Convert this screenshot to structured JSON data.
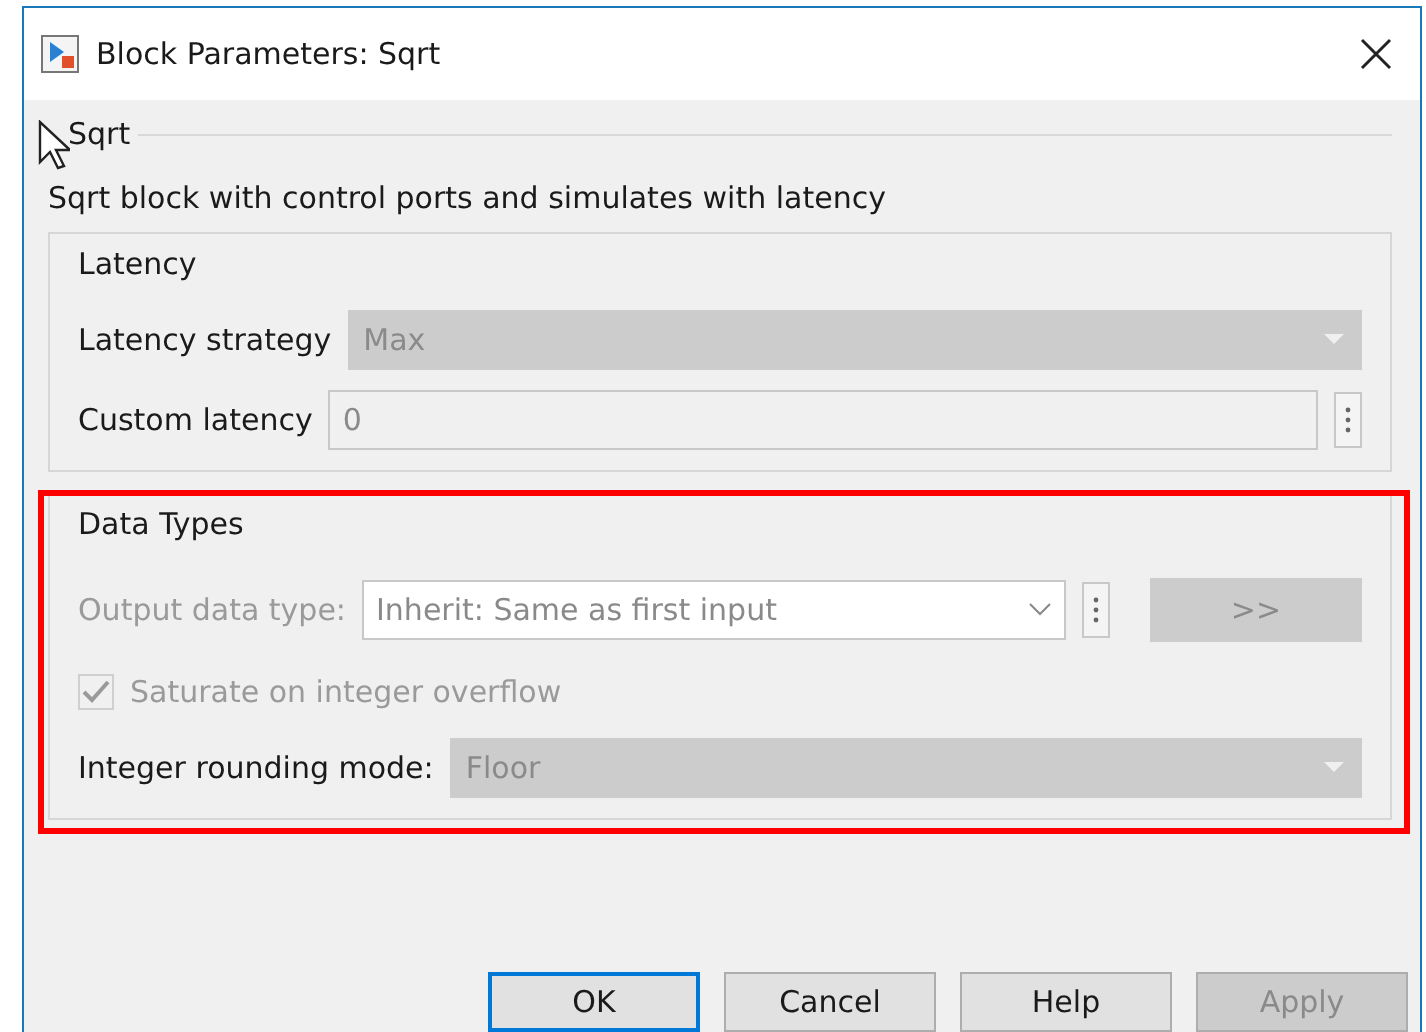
{
  "window": {
    "title": "Block Parameters: Sqrt"
  },
  "block": {
    "name": "Sqrt",
    "description": "Sqrt block with control ports and simulates with latency"
  },
  "latency": {
    "title": "Latency",
    "strategy": {
      "label": "Latency strategy",
      "value": "Max",
      "disabled": true
    },
    "custom": {
      "label": "Custom latency",
      "value": "0",
      "disabled": true
    }
  },
  "data_types": {
    "title": "Data Types",
    "highlighted": true,
    "output": {
      "label": "Output data type:",
      "value": "Inherit: Same as first input",
      "button": ">>",
      "disabled": true
    },
    "saturate": {
      "label": "Saturate on integer overflow",
      "checked": true,
      "disabled": true
    },
    "rounding": {
      "label": "Integer rounding mode:",
      "value": "Floor",
      "disabled": true
    }
  },
  "buttons": [
    {
      "label": "OK",
      "default": true,
      "disabled": false
    },
    {
      "label": "Cancel",
      "default": false,
      "disabled": false
    },
    {
      "label": "Help",
      "default": false,
      "disabled": false
    },
    {
      "label": "Apply",
      "default": false,
      "disabled": true
    }
  ]
}
